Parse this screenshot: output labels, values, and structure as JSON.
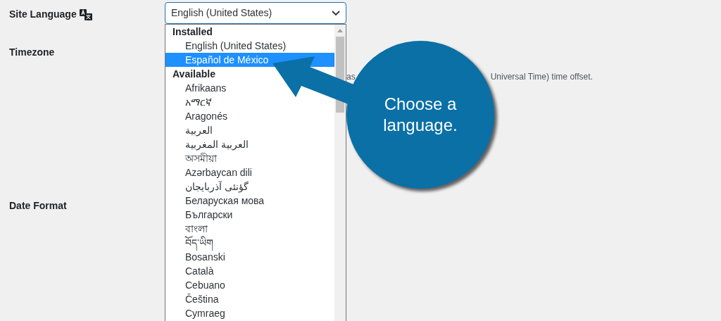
{
  "fields": [
    {
      "label": "Site Language",
      "kind": "language"
    },
    {
      "label": "Timezone",
      "kind": "timezone"
    },
    {
      "label": "Date Format",
      "kind": "date"
    }
  ],
  "timezone_description": [
    "as",
    "Universal Time) time offset."
  ],
  "language_select": {
    "value": "English (United States)",
    "options": [
      {
        "kind": "group",
        "label": "Installed"
      },
      {
        "kind": "option",
        "label": "English (United States)",
        "highlighted": false
      },
      {
        "kind": "option",
        "label": "Español de México",
        "highlighted": true
      },
      {
        "kind": "group",
        "label": "Available"
      },
      {
        "kind": "option",
        "label": "Afrikaans",
        "highlighted": false
      },
      {
        "kind": "option",
        "label": "አማርኛ",
        "highlighted": false
      },
      {
        "kind": "option",
        "label": "Aragonés",
        "highlighted": false
      },
      {
        "kind": "option",
        "label": "العربية",
        "highlighted": false
      },
      {
        "kind": "option",
        "label": "العربية المغربية",
        "highlighted": false
      },
      {
        "kind": "option",
        "label": "অসমীয়া",
        "highlighted": false
      },
      {
        "kind": "option",
        "label": "Azərbaycan dili",
        "highlighted": false
      },
      {
        "kind": "option",
        "label": "گؤنئی آذربایجان",
        "highlighted": false
      },
      {
        "kind": "option",
        "label": "Беларуская мова",
        "highlighted": false
      },
      {
        "kind": "option",
        "label": "Български",
        "highlighted": false
      },
      {
        "kind": "option",
        "label": "বাংলা",
        "highlighted": false
      },
      {
        "kind": "option",
        "label": "བོད་ཡིག",
        "highlighted": false
      },
      {
        "kind": "option",
        "label": "Bosanski",
        "highlighted": false
      },
      {
        "kind": "option",
        "label": "Català",
        "highlighted": false
      },
      {
        "kind": "option",
        "label": "Cebuano",
        "highlighted": false
      },
      {
        "kind": "option",
        "label": "Čeština",
        "highlighted": false
      },
      {
        "kind": "option",
        "label": "Cymraeg",
        "highlighted": false
      }
    ]
  },
  "callout": {
    "text": "Choose a language."
  }
}
